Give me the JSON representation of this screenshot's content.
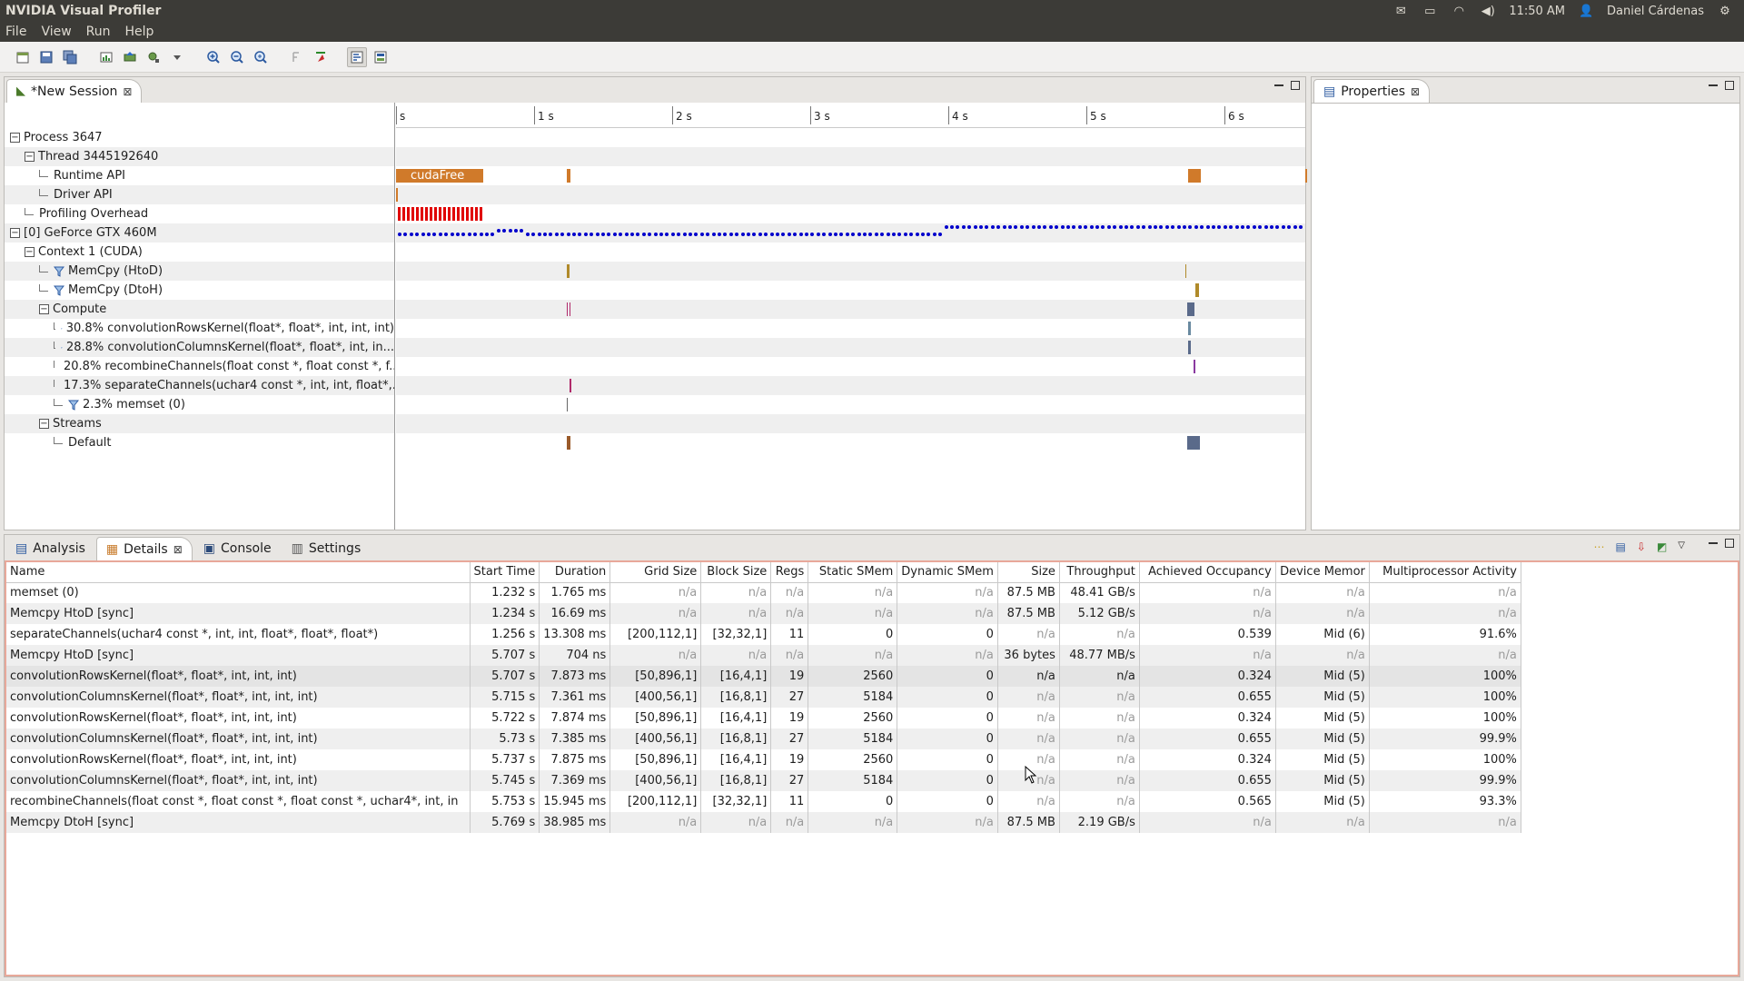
{
  "topbar": {
    "title": "NVIDIA Visual Profiler",
    "time": "11:50 AM",
    "user": "Daniel Cárdenas"
  },
  "menu": [
    "File",
    "View",
    "Run",
    "Help"
  ],
  "session": {
    "tab_label": "*New Session",
    "ticks": [
      "s",
      "1 s",
      "2 s",
      "3 s",
      "4 s",
      "5 s",
      "6 s"
    ],
    "cudafree_label": "cudaFree",
    "tree": [
      {
        "label": "Process 3647",
        "indent": 0,
        "kind": "expander"
      },
      {
        "label": "Thread 3445192640",
        "indent": 1,
        "kind": "expander"
      },
      {
        "label": "Runtime API",
        "indent": 2,
        "kind": "leaf"
      },
      {
        "label": "Driver API",
        "indent": 2,
        "kind": "leaf"
      },
      {
        "label": "Profiling Overhead",
        "indent": 1,
        "kind": "leaf"
      },
      {
        "label": "[0] GeForce GTX 460M",
        "indent": 0,
        "kind": "expander"
      },
      {
        "label": "Context 1 (CUDA)",
        "indent": 1,
        "kind": "expander"
      },
      {
        "label": "MemCpy (HtoD)",
        "indent": 2,
        "kind": "filter"
      },
      {
        "label": "MemCpy (DtoH)",
        "indent": 2,
        "kind": "filter"
      },
      {
        "label": "Compute",
        "indent": 2,
        "kind": "expander"
      },
      {
        "label": "30.8% convolutionRowsKernel(float*, float*, int, int, int)",
        "indent": 3,
        "kind": "filter"
      },
      {
        "label": "28.8% convolutionColumnsKernel(float*, float*, int, in...",
        "indent": 3,
        "kind": "filter"
      },
      {
        "label": "20.8% recombineChannels(float const *, float const *, f...",
        "indent": 3,
        "kind": "filter"
      },
      {
        "label": "17.3% separateChannels(uchar4 const *, int, int, float*,...",
        "indent": 3,
        "kind": "filter"
      },
      {
        "label": "2.3% memset (0)",
        "indent": 3,
        "kind": "filter"
      },
      {
        "label": "Streams",
        "indent": 2,
        "kind": "expander"
      },
      {
        "label": "Default",
        "indent": 3,
        "kind": "leaf"
      }
    ]
  },
  "properties": {
    "tab_label": "Properties"
  },
  "details": {
    "tabs": [
      "Analysis",
      "Details",
      "Console",
      "Settings"
    ],
    "columns": [
      "Name",
      "Start Time",
      "Duration",
      "Grid Size",
      "Block Size",
      "Regs",
      "Static SMem",
      "Dynamic SMem",
      "Size",
      "Throughput",
      "Achieved Occupancy",
      "Device Memor",
      "Multiprocessor Activity"
    ],
    "rows": [
      [
        "memset (0)",
        "1.232 s",
        "1.765 ms",
        "n/a",
        "n/a",
        "n/a",
        "n/a",
        "n/a",
        "87.5 MB",
        "48.41 GB/s",
        "n/a",
        "n/a",
        "n/a"
      ],
      [
        "Memcpy HtoD [sync]",
        "1.234 s",
        "16.69 ms",
        "n/a",
        "n/a",
        "n/a",
        "n/a",
        "n/a",
        "87.5 MB",
        "5.12 GB/s",
        "n/a",
        "n/a",
        "n/a"
      ],
      [
        "separateChannels(uchar4 const *, int, int, float*, float*, float*)",
        "1.256 s",
        "13.308 ms",
        "[200,112,1]",
        "[32,32,1]",
        "11",
        "0",
        "0",
        "n/a",
        "n/a",
        "0.539",
        "Mid (6)",
        "91.6%"
      ],
      [
        "Memcpy HtoD [sync]",
        "5.707 s",
        "704 ns",
        "n/a",
        "n/a",
        "n/a",
        "n/a",
        "n/a",
        "36 bytes",
        "48.77 MB/s",
        "n/a",
        "n/a",
        "n/a"
      ],
      [
        "convolutionRowsKernel(float*, float*, int, int, int)",
        "5.707 s",
        "7.873 ms",
        "[50,896,1]",
        "[16,4,1]",
        "19",
        "2560",
        "0",
        "n/a",
        "n/a",
        "0.324",
        "Mid (5)",
        "100%"
      ],
      [
        "convolutionColumnsKernel(float*, float*, int, int, int)",
        "5.715 s",
        "7.361 ms",
        "[400,56,1]",
        "[16,8,1]",
        "27",
        "5184",
        "0",
        "n/a",
        "n/a",
        "0.655",
        "Mid (5)",
        "100%"
      ],
      [
        "convolutionRowsKernel(float*, float*, int, int, int)",
        "5.722 s",
        "7.874 ms",
        "[50,896,1]",
        "[16,4,1]",
        "19",
        "2560",
        "0",
        "n/a",
        "n/a",
        "0.324",
        "Mid (5)",
        "100%"
      ],
      [
        "convolutionColumnsKernel(float*, float*, int, int, int)",
        "5.73 s",
        "7.385 ms",
        "[400,56,1]",
        "[16,8,1]",
        "27",
        "5184",
        "0",
        "n/a",
        "n/a",
        "0.655",
        "Mid (5)",
        "99.9%"
      ],
      [
        "convolutionRowsKernel(float*, float*, int, int, int)",
        "5.737 s",
        "7.875 ms",
        "[50,896,1]",
        "[16,4,1]",
        "19",
        "2560",
        "0",
        "n/a",
        "n/a",
        "0.324",
        "Mid (5)",
        "100%"
      ],
      [
        "convolutionColumnsKernel(float*, float*, int, int, int)",
        "5.745 s",
        "7.369 ms",
        "[400,56,1]",
        "[16,8,1]",
        "27",
        "5184",
        "0",
        "n/a",
        "n/a",
        "0.655",
        "Mid (5)",
        "99.9%"
      ],
      [
        "recombineChannels(float const *, float const *, float const *, uchar4*, int, in",
        "5.753 s",
        "15.945 ms",
        "[200,112,1]",
        "[32,32,1]",
        "11",
        "0",
        "0",
        "n/a",
        "n/a",
        "0.565",
        "Mid (5)",
        "93.3%"
      ],
      [
        "Memcpy DtoH [sync]",
        "5.769 s",
        "38.985 ms",
        "n/a",
        "n/a",
        "n/a",
        "n/a",
        "n/a",
        "87.5 MB",
        "2.19 GB/s",
        "n/a",
        "n/a",
        "n/a"
      ]
    ]
  },
  "colors": {
    "cuda_orange": "#d07a2a",
    "overhead_red": "#e00000",
    "gpu_blue": "#0000cc",
    "kernel_slate": "#5a6a8a"
  }
}
